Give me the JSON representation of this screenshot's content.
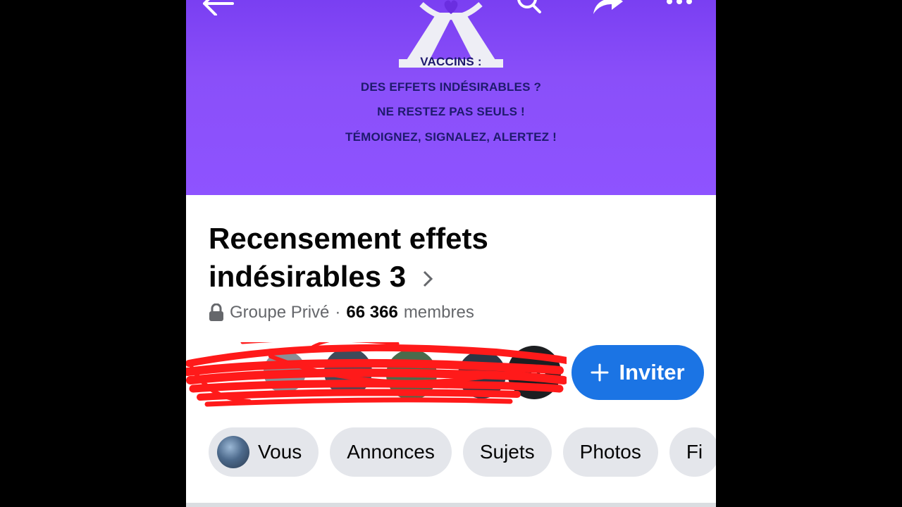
{
  "cover": {
    "lines": [
      "VACCINS :",
      "DES EFFETS INDÉSIRABLES ?",
      "NE RESTEZ PAS SEULS !",
      "TÉMOIGNEZ, SIGNALEZ, ALERTEZ !"
    ],
    "background": "#8e53ff",
    "text_color": "#1e1a6d"
  },
  "toolbar": {
    "icons": [
      "back-arrow-icon",
      "search-icon",
      "share-icon",
      "more-icon"
    ]
  },
  "group": {
    "name": "Recensement effets indésirables 3",
    "privacy": "Groupe Privé",
    "separator": "·",
    "member_count": "66 366",
    "member_label": "membres"
  },
  "invite": {
    "label": "Inviter",
    "icon": "plus-icon",
    "color": "#1b74e4"
  },
  "tabs": [
    {
      "label": "Vous"
    },
    {
      "label": "Annonces"
    },
    {
      "label": "Sujets"
    },
    {
      "label": "Photos"
    },
    {
      "label": "Fi"
    }
  ]
}
